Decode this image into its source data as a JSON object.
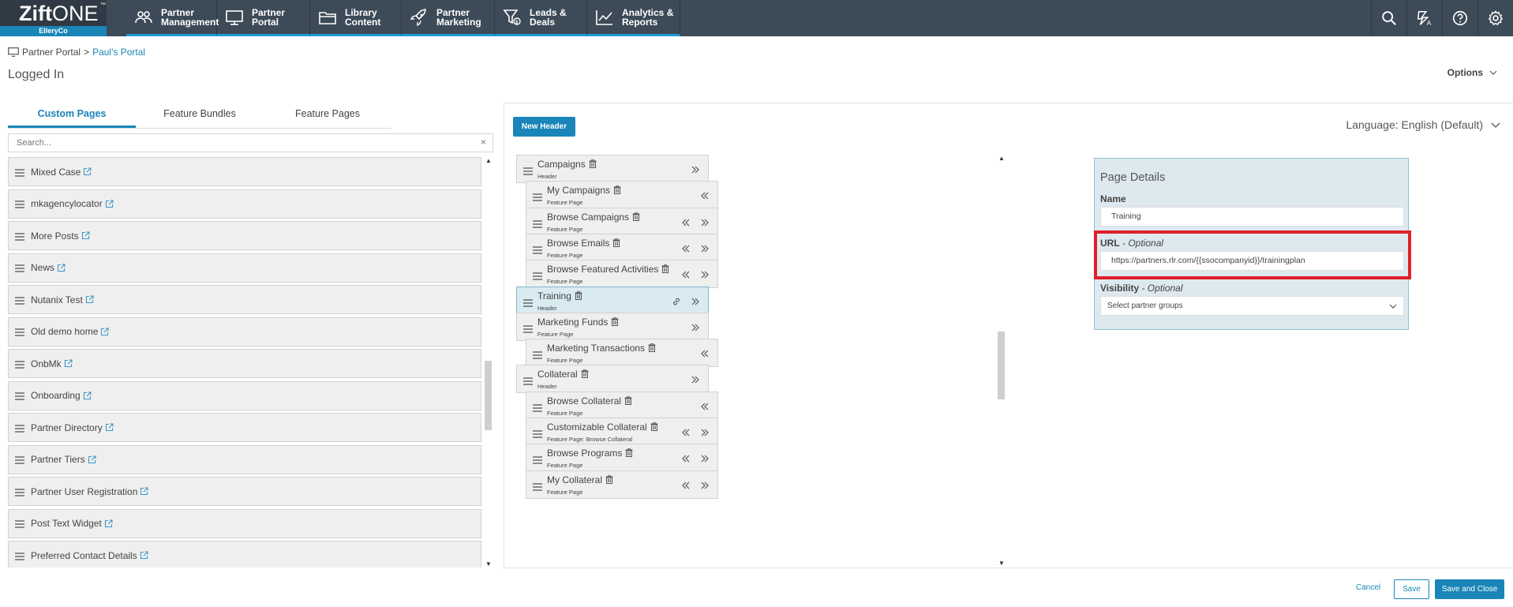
{
  "app": {
    "brand_main": "Zift",
    "brand_one": "ONE",
    "tm": "™",
    "company": "ElleryCo"
  },
  "nav": {
    "items": [
      {
        "label": "Partner\nManagement",
        "icon": "partners-icon"
      },
      {
        "label": "Partner\nPortal",
        "icon": "monitor-icon"
      },
      {
        "label": "Library\nContent",
        "icon": "folder-icon"
      },
      {
        "label": "Partner\nMarketing",
        "icon": "rocket-icon"
      },
      {
        "label": "Leads &\nDeals",
        "icon": "funnel-dollar-icon"
      },
      {
        "label": "Analytics &\nReports",
        "icon": "line-chart-icon"
      }
    ],
    "right_icons": [
      "search-icon",
      "translate-icon",
      "help-icon",
      "gear-icon"
    ],
    "accent": "#1f9bd6"
  },
  "breadcrumb": {
    "root": "Partner Portal",
    "separator": ">",
    "current": "Paul's Portal"
  },
  "page": {
    "title": "Logged In",
    "options_label": "Options"
  },
  "left": {
    "tabs": [
      "Custom Pages",
      "Feature Bundles",
      "Feature Pages"
    ],
    "active_tab": "Custom Pages",
    "search_placeholder": "Search...",
    "search_clear": "×",
    "items": [
      "Mixed Case",
      "mkagencylocator",
      "More Posts",
      "News",
      "Nutanix Test",
      "Old demo home",
      "OnbMk",
      "Onboarding",
      "Partner Directory",
      "Partner Tiers",
      "Partner User Registration",
      "Post Text Widget",
      "Preferred Contact Details"
    ]
  },
  "center": {
    "new_header_label": "New Header",
    "language_label": "Language: English (Default)",
    "tree": [
      {
        "name": "Campaigns",
        "type": "Header",
        "level": 0,
        "ctrls": [
          "right"
        ]
      },
      {
        "name": "My Campaigns",
        "type": "Feature Page",
        "level": 1,
        "ctrls": [
          "left"
        ]
      },
      {
        "name": "Browse Campaigns",
        "type": "Feature Page",
        "level": 1,
        "ctrls": [
          "left",
          "right"
        ]
      },
      {
        "name": "Browse Emails",
        "type": "Feature Page",
        "level": 1,
        "ctrls": [
          "left",
          "right"
        ]
      },
      {
        "name": "Browse Featured Activities",
        "type": "Feature Page",
        "level": 1,
        "ctrls": [
          "left",
          "right"
        ]
      },
      {
        "name": "Training",
        "type": "Header",
        "level": 0,
        "ctrls": [
          "link",
          "right"
        ],
        "selected": true
      },
      {
        "name": "Marketing Funds",
        "type": "Feature Page",
        "level": 0,
        "ctrls": [
          "right"
        ]
      },
      {
        "name": "Marketing Transactions",
        "type": "Feature Page",
        "level": 1,
        "ctrls": [
          "left"
        ]
      },
      {
        "name": "Collateral",
        "type": "Header",
        "level": 0,
        "ctrls": [
          "right"
        ]
      },
      {
        "name": "Browse Collateral",
        "type": "Feature Page",
        "level": 1,
        "ctrls": [
          "left"
        ]
      },
      {
        "name": "Customizable Collateral",
        "type": "Feature Page: Browse Collateral",
        "level": 1,
        "ctrls": [
          "left",
          "right"
        ]
      },
      {
        "name": "Browse Programs",
        "type": "Feature Page",
        "level": 1,
        "ctrls": [
          "left",
          "right"
        ]
      },
      {
        "name": "My Collateral",
        "type": "Feature Page",
        "level": 1,
        "ctrls": [
          "left",
          "right"
        ]
      }
    ]
  },
  "details": {
    "title": "Page Details",
    "name_label": "Name",
    "name_value": "Training",
    "url_label": "URL",
    "url_optional": " - Optional",
    "url_value": "https://partners.rlr.com/{{ssocompanyid}}/trainingplan",
    "visibility_label": "Visibility",
    "visibility_optional": " - Optional",
    "visibility_placeholder": "Select partner groups",
    "highlight_color": "#e0202a"
  },
  "footer": {
    "cancel": "Cancel",
    "save": "Save",
    "save_close": "Save and Close"
  }
}
